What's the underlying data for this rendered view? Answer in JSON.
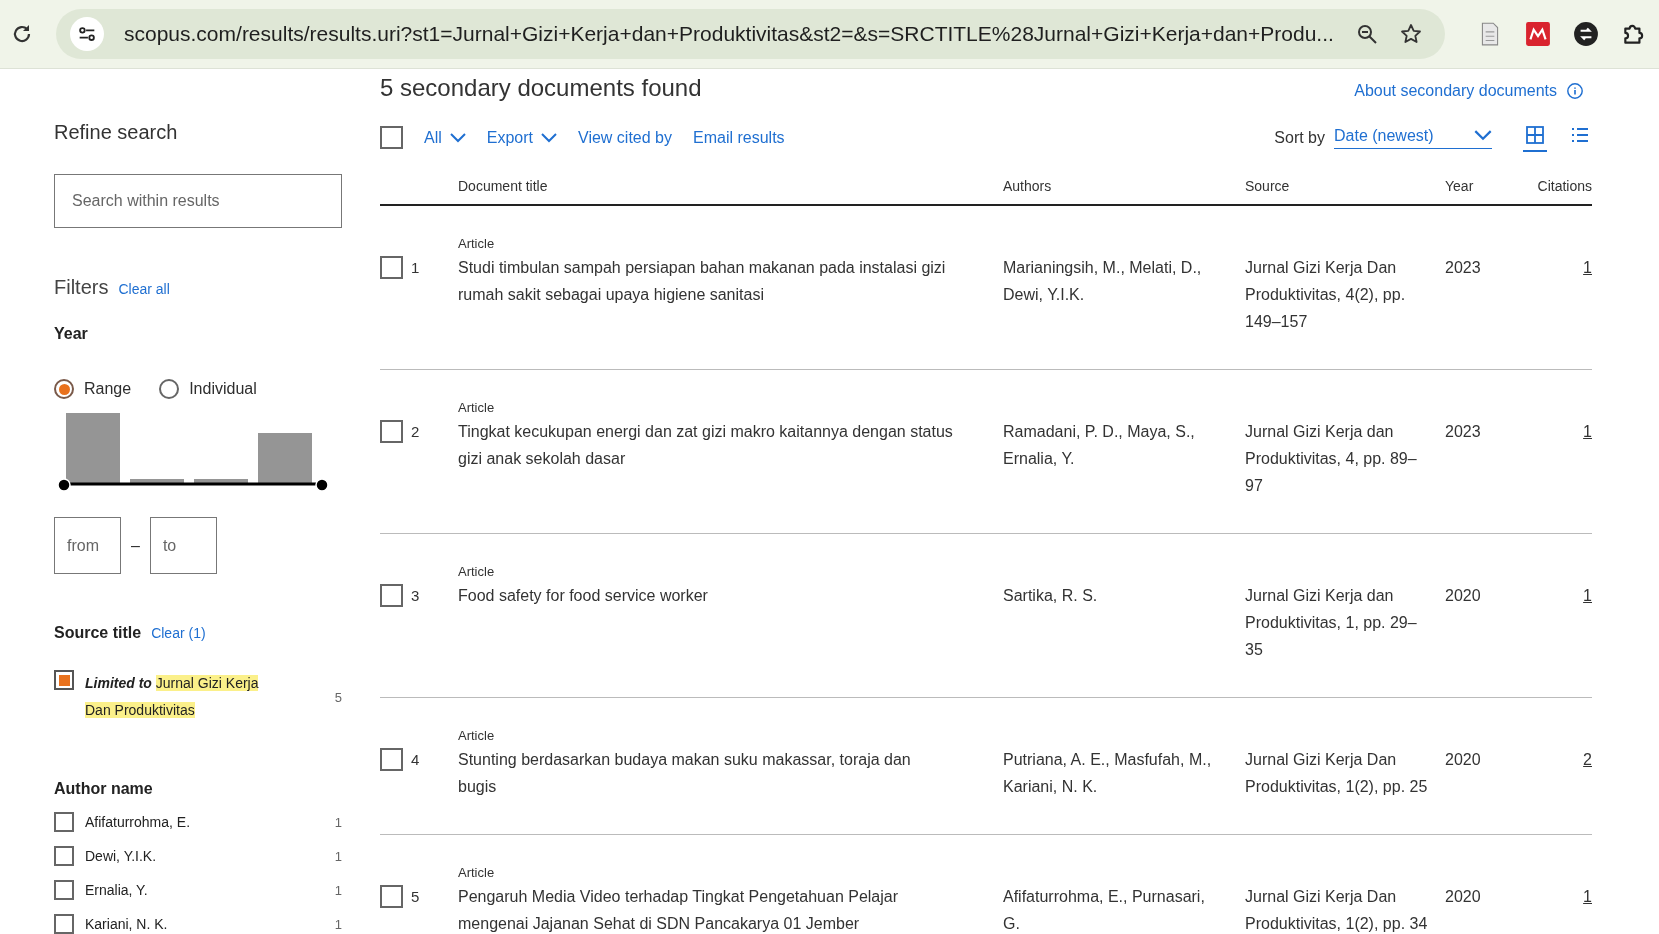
{
  "browser": {
    "url": "scopus.com/results/results.uri?st1=Jurnal+Gizi+Kerja+dan+Produktivitas&st2=&s=SRCTITLE%28Jurnal+Gizi+Kerja+dan+Produ..."
  },
  "sidebar": {
    "title": "Refine search",
    "search": {
      "placeholder": "Search within results"
    },
    "filters_title": "Filters",
    "clear_all": "Clear all",
    "year": {
      "label": "Year",
      "modes": [
        {
          "label": "Range",
          "selected": true
        },
        {
          "label": "Individual",
          "selected": false
        }
      ],
      "from": {
        "placeholder": "from"
      },
      "separator": "–",
      "to": {
        "placeholder": "to"
      }
    },
    "source_title": {
      "label": "Source title",
      "clear": "Clear (1)",
      "items": [
        {
          "prefix": "Limited to",
          "name": "Jurnal Gizi Kerja Dan Produktivitas",
          "count": "5",
          "checked": true
        }
      ]
    },
    "author_name": {
      "label": "Author name",
      "items": [
        {
          "name": "Afifaturrohma, E.",
          "count": "1",
          "checked": false
        },
        {
          "name": "Dewi, Y.I.K.",
          "count": "1",
          "checked": false
        },
        {
          "name": "Ernalia, Y.",
          "count": "1",
          "checked": false
        },
        {
          "name": "Kariani, N. K.",
          "count": "1",
          "checked": false
        }
      ]
    }
  },
  "results": {
    "heading": "5 secondary documents found",
    "about": "About secondary documents",
    "toolbar": {
      "select_all_checked": false,
      "all": "All",
      "export": "Export",
      "view_cited_by": "View cited by",
      "email": "Email results",
      "sort_label": "Sort by",
      "sort_value": "Date (newest)",
      "views": [
        {
          "kind": "grid",
          "selected": true
        },
        {
          "kind": "list",
          "selected": false
        }
      ]
    },
    "table": {
      "columns": [
        "Document title",
        "Authors",
        "Source",
        "Year",
        "Citations"
      ],
      "rows": [
        {
          "checked": false,
          "number": "1",
          "type": "Article",
          "title": "Studi timbulan sampah persiapan bahan makanan pada instalasi gizi rumah sakit sebagai upaya higiene sanitasi",
          "authors": "Marianingsih, M., Melati, D., Dewi, Y.I.K.",
          "source": "Jurnal Gizi Kerja Dan Produktivitas, 4(2), pp. 149–157",
          "year": "2023",
          "citations": "1"
        },
        {
          "checked": false,
          "number": "2",
          "type": "Article",
          "title": "Tingkat kecukupan energi dan zat gizi makro kaitannya dengan status gizi anak sekolah dasar",
          "authors": "Ramadani, P. D., Maya, S., Ernalia, Y.",
          "source": "Jurnal Gizi Kerja dan Produktivitas, 4, pp. 89–97",
          "year": "2023",
          "citations": "1"
        },
        {
          "checked": false,
          "number": "3",
          "type": "Article",
          "title": "Food safety for food service worker",
          "authors": "Sartika, R. S.",
          "source": "Jurnal Gizi Kerja dan Produktivitas, 1, pp. 29–35",
          "year": "2020",
          "citations": "1"
        },
        {
          "checked": false,
          "number": "4",
          "type": "Article",
          "title": "Stunting berdasarkan budaya makan suku makassar, toraja dan bugis",
          "authors": "Putriana, A. E., Masfufah, M., Kariani, N. K.",
          "source": "Jurnal Gizi Kerja Dan Produktivitas, 1(2), pp. 25",
          "year": "2020",
          "citations": "2"
        },
        {
          "checked": false,
          "number": "5",
          "type": "Article",
          "title": "Pengaruh Media Video terhadap Tingkat Pengetahuan Pelajar mengenai Jajanan Sehat di SDN Pancakarya 01 Jember",
          "authors": "Afifaturrohma, E., Purnasari, G.",
          "source": "Jurnal Gizi Kerja Dan Produktivitas, 1(2), pp. 34",
          "year": "2020",
          "citations": "1"
        }
      ]
    }
  }
}
